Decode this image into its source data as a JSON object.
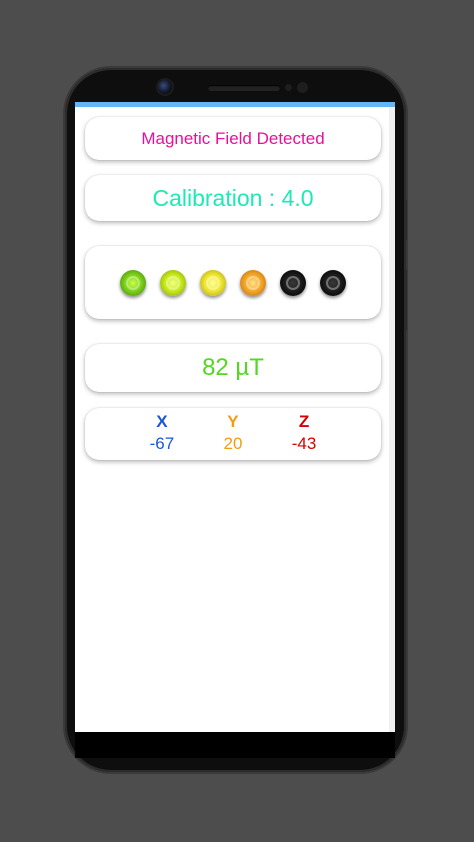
{
  "app": {
    "status_message": "Magnetic Field Detected",
    "calibration": "Calibration : 4.0",
    "field_strength": "82 µT"
  },
  "indicator": {
    "leds": [
      {
        "name": "led-1",
        "state": "on",
        "color": "#7dd21c"
      },
      {
        "name": "led-2",
        "state": "on",
        "color": "#c9ea1c"
      },
      {
        "name": "led-3",
        "state": "on",
        "color": "#efe733"
      },
      {
        "name": "led-4",
        "state": "on",
        "color": "#f4a82a"
      },
      {
        "name": "led-5",
        "state": "off",
        "color": "#000000"
      },
      {
        "name": "led-6",
        "state": "off",
        "color": "#000000"
      }
    ],
    "active_count": 4,
    "total_count": 6
  },
  "axes": {
    "x": {
      "label": "X",
      "value": "-67",
      "color": "#1a56db"
    },
    "y": {
      "label": "Y",
      "value": "20",
      "color": "#f39c12"
    },
    "z": {
      "label": "Z",
      "value": "-43",
      "color": "#d50000"
    }
  },
  "colors": {
    "status": "#e8109b",
    "calibration": "#1de9b6",
    "field": "#51d81f",
    "background": "#4d4d4d"
  }
}
